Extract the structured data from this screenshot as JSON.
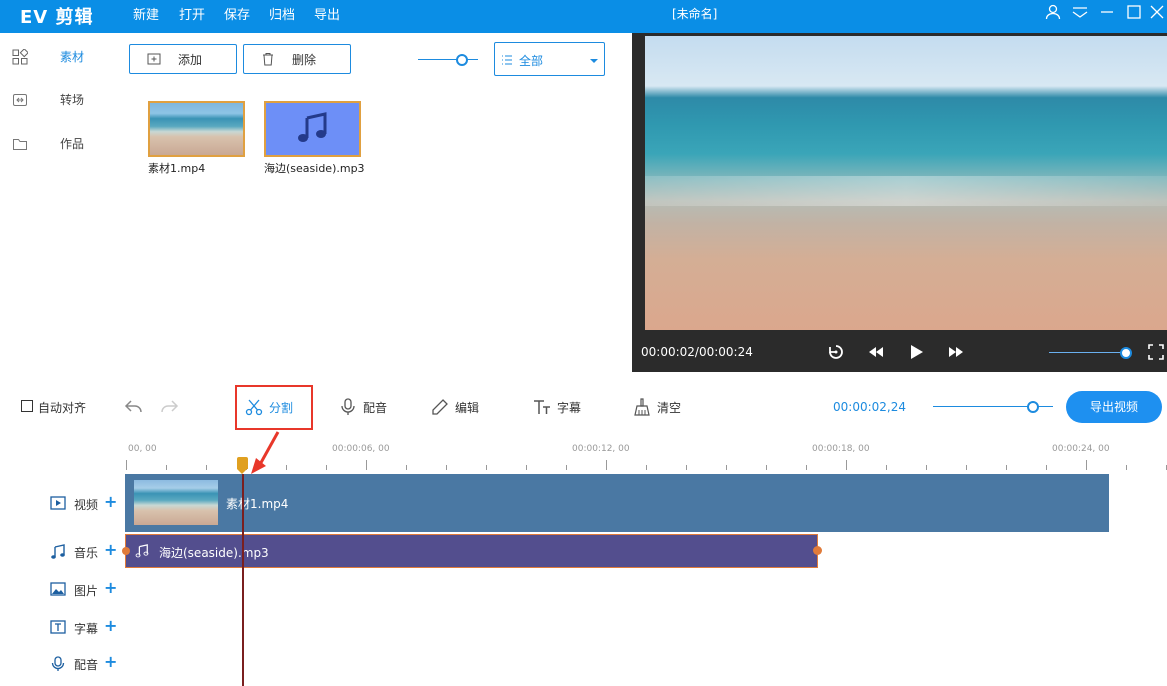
{
  "app": {
    "logo": "EV 剪辑",
    "menu": [
      "新建",
      "打开",
      "保存",
      "归档",
      "导出"
    ],
    "document_title": "[未命名]"
  },
  "sidebar": {
    "items": [
      {
        "label": "素材",
        "icon": "grid-icon",
        "active": true
      },
      {
        "label": "转场",
        "icon": "transition-icon",
        "active": false
      },
      {
        "label": "作品",
        "icon": "folder-icon",
        "active": false
      }
    ]
  },
  "media_toolbar": {
    "add_label": "添加",
    "delete_label": "删除",
    "filter_value": "全部",
    "thumb_size_level": 0.8
  },
  "assets": [
    {
      "name": "素材1.mp4",
      "type": "video"
    },
    {
      "name": "海边(seaside).mp3",
      "type": "audio"
    }
  ],
  "preview": {
    "time": "00:00:02/00:00:24",
    "volume_level": 0.95
  },
  "edit_toolbar": {
    "auto_align": "自动对齐",
    "split": "分割",
    "dub": "配音",
    "edit": "编辑",
    "subtitle": "字幕",
    "clear": "清空",
    "current_time": "00:00:02,24",
    "zoom_level": 0.85,
    "export": "导出视频"
  },
  "ruler": {
    "labels": [
      "00, 00",
      "00:00:06, 00",
      "00:00:12, 00",
      "00:00:18, 00",
      "00:00:24, 00"
    ]
  },
  "tracks": [
    {
      "label": "视频",
      "icon": "video-track-icon"
    },
    {
      "label": "音乐",
      "icon": "music-track-icon"
    },
    {
      "label": "图片",
      "icon": "image-track-icon"
    },
    {
      "label": "字幕",
      "icon": "text-track-icon"
    },
    {
      "label": "配音",
      "icon": "mic-track-icon"
    }
  ],
  "clips": {
    "video": "素材1.mp4",
    "audio": "海边(seaside).mp3"
  },
  "colors": {
    "accent": "#1d8bdf",
    "titlebar": "#0a8ee6",
    "video_clip": "#4a78a3",
    "audio_clip": "#534e8e",
    "highlight": "#e8372a"
  }
}
